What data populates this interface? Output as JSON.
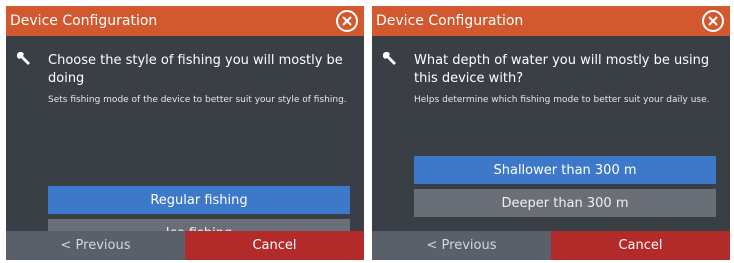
{
  "colors": {
    "titlebar": "#d2592f",
    "panel": "#3a3f46",
    "selected_option": "#3e78c9",
    "option": "#6a6f77",
    "previous_button": "#5a6069",
    "cancel_button": "#b32a2a"
  },
  "dialogs": [
    {
      "title": "Device Configuration",
      "close_icon": "close-circle-icon",
      "step_icon": "wrench-icon",
      "question": "Choose the style of fishing you will mostly be doing",
      "hint": "Sets fishing mode of the device to better suit your style of fishing.",
      "options": [
        {
          "label": "Regular fishing",
          "selected": true
        },
        {
          "label": "Ice fishing",
          "selected": false
        }
      ],
      "previous_label": "< Previous",
      "cancel_label": "Cancel"
    },
    {
      "title": "Device Configuration",
      "close_icon": "close-circle-icon",
      "step_icon": "wrench-icon",
      "question": "What depth of water you will mostly be using this device with?",
      "hint": "Helps determine which fishing mode to better suit your daily use.",
      "options": [
        {
          "label": "Shallower than 300 m",
          "selected": true
        },
        {
          "label": "Deeper than 300 m",
          "selected": false
        }
      ],
      "previous_label": "< Previous",
      "cancel_label": "Cancel"
    }
  ]
}
